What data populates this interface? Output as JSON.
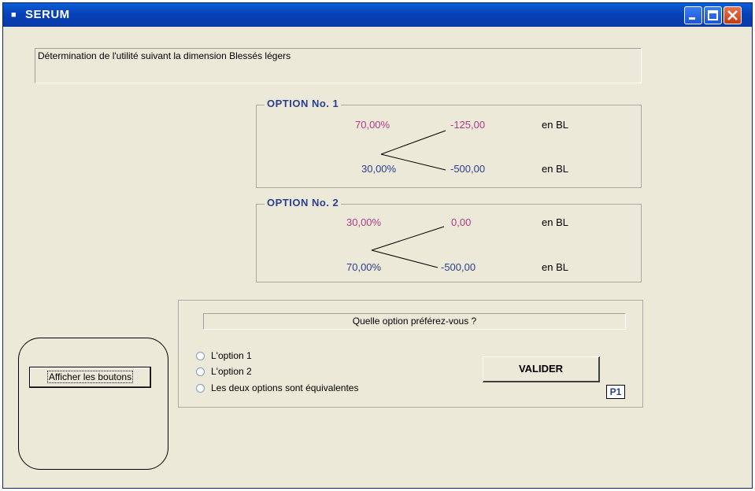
{
  "window": {
    "title": "SERUM"
  },
  "description": "Détermination de l'utilité suivant la dimension Blessés légers",
  "option1": {
    "title": "OPTION No. 1",
    "top_prob": "70,00%",
    "top_value": "-125,00",
    "bottom_prob": "30,00%",
    "bottom_value": "-500,00",
    "unit": "en BL"
  },
  "option2": {
    "title": "OPTION No. 2",
    "top_prob": "30,00%",
    "top_value": "0,00",
    "bottom_prob": "70,00%",
    "bottom_value": "-500,00",
    "unit": "en BL"
  },
  "question": "Quelle option préférez-vous ?",
  "radios": [
    "L'option 1",
    "L'option 2",
    "Les deux options sont équivalentes"
  ],
  "buttons": {
    "valider": "VALIDER",
    "afficher": "Afficher les boutons"
  },
  "page_indicator": "P1",
  "colors": {
    "pink": "#b03a8a",
    "blue": "#2a3f8f",
    "background": "#ece9d8",
    "titlebar": "#0a4fc8"
  }
}
